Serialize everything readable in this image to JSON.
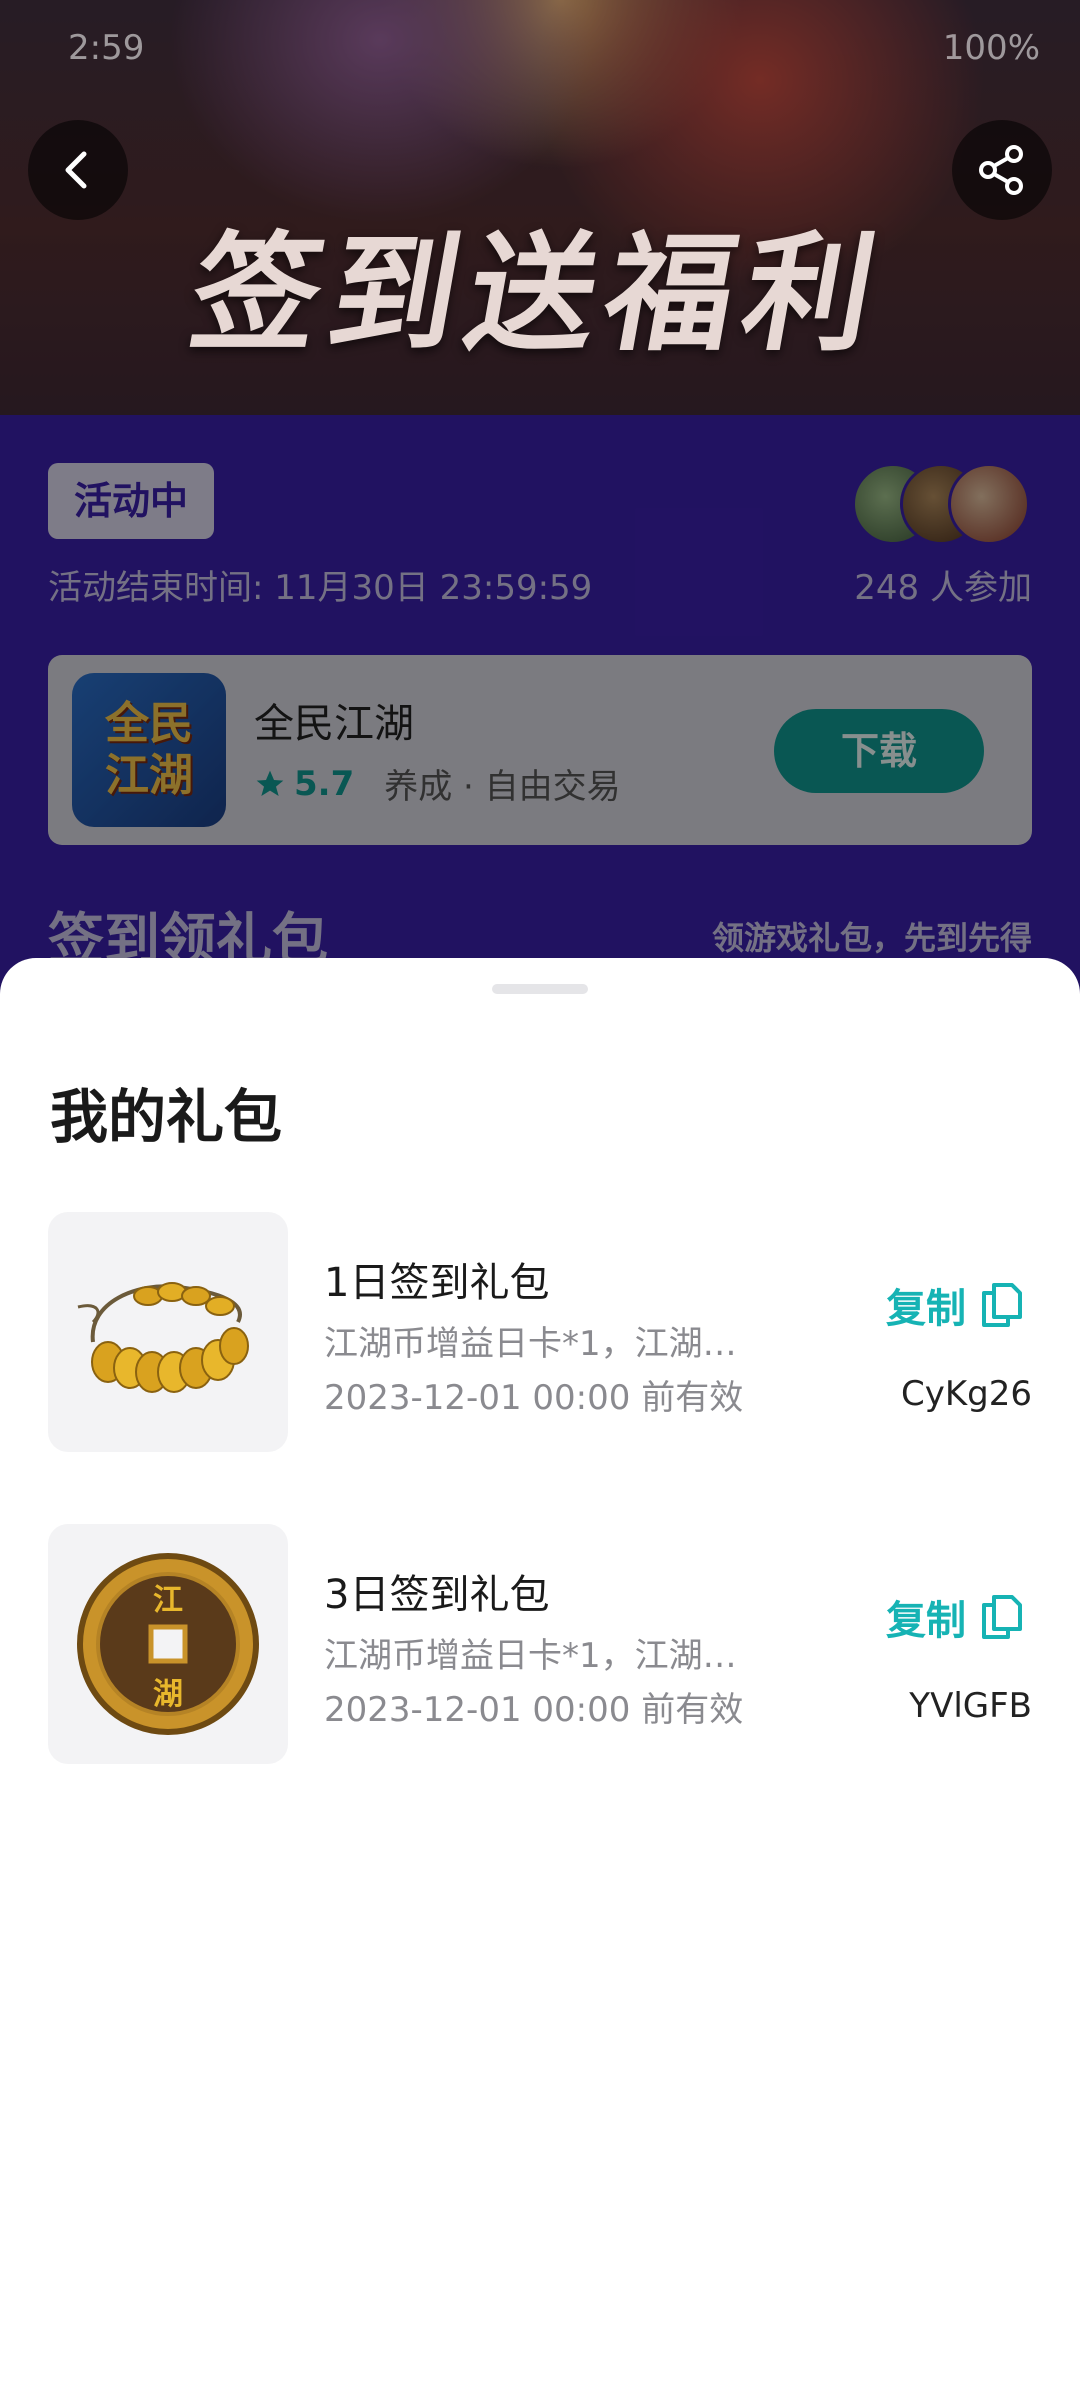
{
  "status_bar": {
    "time": "2:59",
    "battery": "100%"
  },
  "banner": {
    "title": "签到送福利"
  },
  "activity": {
    "status": "活动中",
    "end_time": "活动结束时间: 11月30日 23:59:59",
    "participants": "248 人参加"
  },
  "game": {
    "name": "全民江湖",
    "rating": "5.7",
    "tags": "养成 · 自由交易",
    "logo_text_line1": "全民",
    "logo_text_line2": "江湖",
    "download_label": "下载"
  },
  "section": {
    "title": "签到领礼包",
    "subtitle": "领游戏礼包，先到先得"
  },
  "sheet": {
    "title": "我的礼包",
    "gifts": [
      {
        "name": "1日签到礼包",
        "desc": "江湖币增益日卡*1，江湖…",
        "expiry": "2023-12-01 00:00 前有效",
        "copy_label": "复制",
        "code": "CyKg26"
      },
      {
        "name": "3日签到礼包",
        "desc": "江湖币增益日卡*1，江湖…",
        "expiry": "2023-12-01 00:00 前有效",
        "copy_label": "复制",
        "code": "YVlGFB"
      }
    ]
  },
  "colors": {
    "accent_teal": "#16b3b4",
    "purple_bg": "#3a1fa8",
    "download_green": "#11968f"
  },
  "icons": [
    "back-arrow-icon",
    "share-icon",
    "star-icon",
    "copy-icon"
  ]
}
